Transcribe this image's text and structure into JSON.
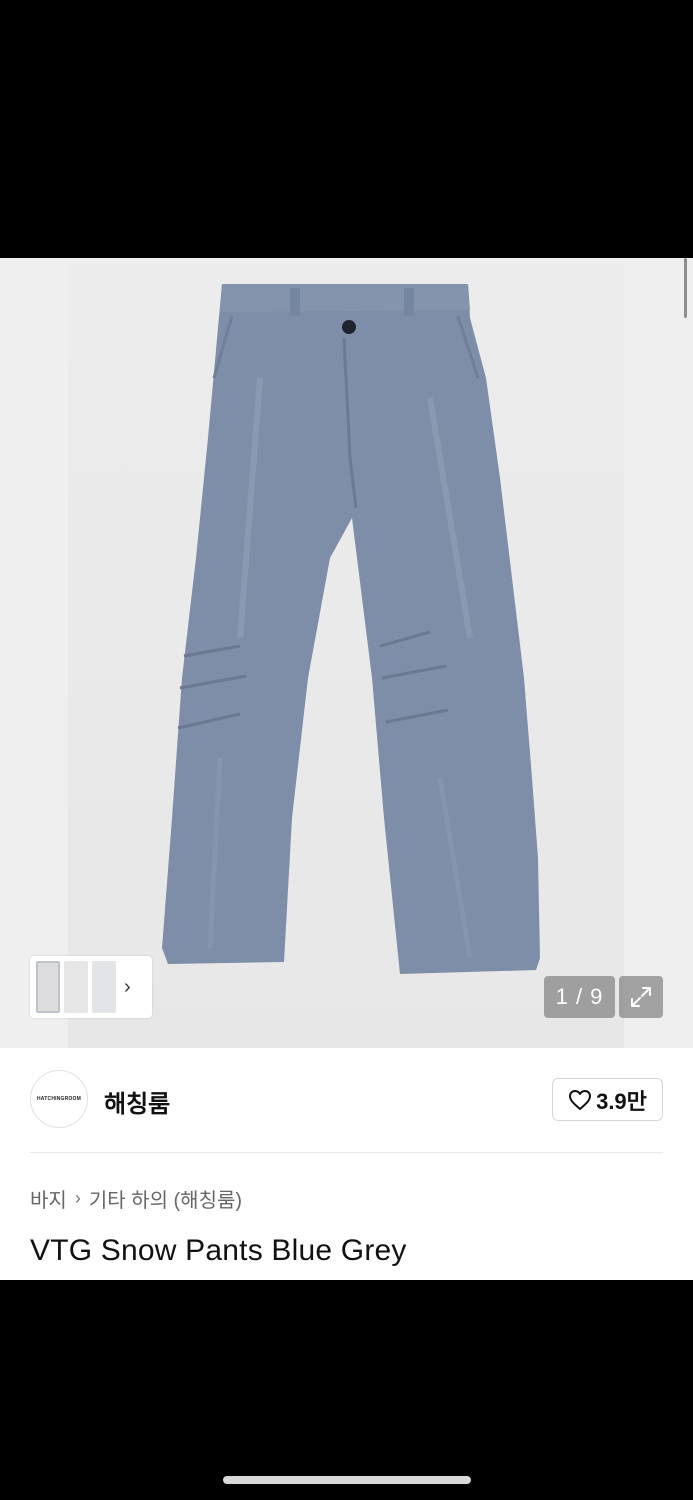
{
  "gallery": {
    "counter": "1 / 9",
    "thumb_arrow": "›",
    "icons": [
      "expand-icon",
      "chevron-right-icon"
    ]
  },
  "shop": {
    "logo_text": "HATCHINGROOM",
    "name": "해칭룸",
    "likes": "3.9만"
  },
  "breadcrumb": {
    "category": "바지",
    "separator": "›",
    "subcategory": "기타 하의 (해칭룸)"
  },
  "product": {
    "title": "VTG Snow Pants Blue Grey"
  },
  "colors": {
    "pants": "#7f8ea8",
    "background": "#efefef"
  }
}
